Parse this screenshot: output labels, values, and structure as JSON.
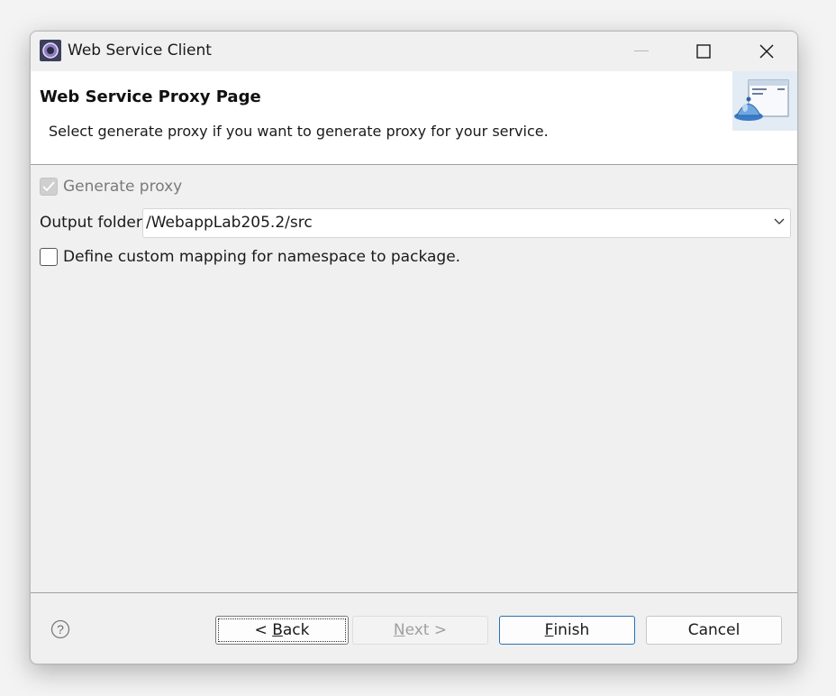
{
  "window": {
    "title": "Web Service Client"
  },
  "banner": {
    "title": "Web Service Proxy Page",
    "description": "Select generate proxy if you want to generate proxy for your service."
  },
  "form": {
    "generate_proxy_label": "Generate proxy",
    "generate_proxy_checked": true,
    "generate_proxy_enabled": false,
    "output_folder_label": "Output folder",
    "output_folder_value": "/WebappLab205.2/src",
    "custom_mapping_label": "Define custom mapping for namespace to package.",
    "custom_mapping_checked": false
  },
  "buttons": {
    "back": {
      "prefix": "< ",
      "mnemonic": "B",
      "rest": "ack"
    },
    "next": {
      "mnemonic": "N",
      "rest": "ext >"
    },
    "finish": {
      "mnemonic": "F",
      "rest": "inish"
    },
    "cancel": "Cancel"
  },
  "colors": {
    "finish_border": "#2b6fb6",
    "dialog_bg": "#f0f0f0",
    "banner_bg": "#ffffff"
  },
  "icons": [
    "app-icon",
    "minimize-icon",
    "maximize-icon",
    "close-icon",
    "wizard-banner-icon",
    "checkmark-icon",
    "chevron-down-icon",
    "help-icon"
  ]
}
